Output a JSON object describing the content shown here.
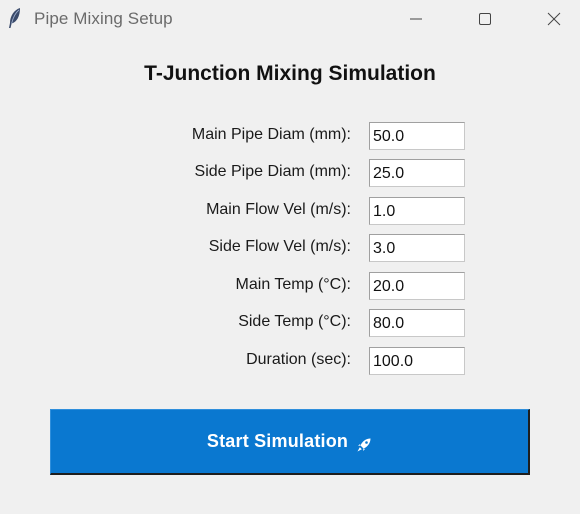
{
  "window": {
    "title": "Pipe Mixing Setup",
    "app_icon": "feather-icon",
    "controls": {
      "minimize_icon": "minimize-icon",
      "maximize_icon": "maximize-icon",
      "close_icon": "close-icon"
    }
  },
  "main": {
    "heading": "T-Junction Mixing Simulation",
    "fields": [
      {
        "label": "Main Pipe Diam (mm):",
        "value": "50.0"
      },
      {
        "label": "Side Pipe Diam (mm):",
        "value": "25.0"
      },
      {
        "label": "Main Flow Vel (m/s):",
        "value": "1.0"
      },
      {
        "label": "Side Flow Vel (m/s):",
        "value": "3.0"
      },
      {
        "label": "Main Temp (°C):",
        "value": "20.0"
      },
      {
        "label": "Side Temp (°C):",
        "value": "80.0"
      },
      {
        "label": "Duration (sec):",
        "value": "100.0"
      }
    ],
    "start_button": {
      "label": "Start Simulation",
      "icon": "rocket-icon"
    }
  },
  "colors": {
    "background": "#f0f0f0",
    "button_blue": "#0a78d0",
    "button_text": "#ffffff"
  }
}
